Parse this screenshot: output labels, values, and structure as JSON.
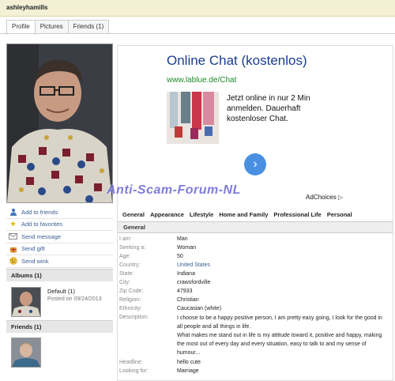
{
  "topbar": {
    "username": "ashleyhamills"
  },
  "tabs": [
    {
      "label": "Profile",
      "active": true
    },
    {
      "label": "Pictures",
      "active": false
    },
    {
      "label": "Friends (1)",
      "active": false
    }
  ],
  "actions": [
    {
      "label": "Add to friends",
      "icon": "person-icon"
    },
    {
      "label": "Add to favorites",
      "icon": "star-icon"
    },
    {
      "label": "Send message",
      "icon": "envelope-icon"
    },
    {
      "label": "Send gift",
      "icon": "gift-icon"
    },
    {
      "label": "Send wink",
      "icon": "smiley-icon"
    }
  ],
  "albums": {
    "heading": "Albums (1)",
    "items": [
      {
        "name": "Default (1)",
        "posted": "Posted on 09/24/2013"
      }
    ]
  },
  "friends": {
    "heading": "Friends (1)"
  },
  "ad": {
    "title": "Online Chat (kostenlos)",
    "url": "www.lablue.de/Chat",
    "text": "Jetzt online in nur 2 Min anmelden. Dauerhaft kostenloser Chat.",
    "adchoices": "AdChoices"
  },
  "watermark": "Anti-Scam-Forum-NL",
  "profile_tabs": [
    "General",
    "Appearance",
    "Lifestyle",
    "Home and Family",
    "Professional Life",
    "Personal"
  ],
  "general": {
    "heading": "General",
    "fields": [
      {
        "key": "I am:",
        "value": "Man",
        "link": false
      },
      {
        "key": "Seeking a:",
        "value": "Woman",
        "link": false
      },
      {
        "key": "Age:",
        "value": "50",
        "link": false
      },
      {
        "key": "Country:",
        "value": "United States",
        "link": true
      },
      {
        "key": "State:",
        "value": "Indiana",
        "link": false
      },
      {
        "key": "City:",
        "value": "crawsfordville",
        "link": false
      },
      {
        "key": "Zip Code:",
        "value": "47933",
        "link": false
      },
      {
        "key": "Religion:",
        "value": "Christian",
        "link": false
      },
      {
        "key": "Ethnicity:",
        "value": "Caucasian (white)",
        "link": false
      },
      {
        "key": "Description:",
        "value": "I choose to be a happy positive person, I am pretty easy going, I look for the good in all people and all things in life.\nWhat makes me stand out in life is my attitude toward it, positive and happy, making the most out of every day and every situation, easy to talk to and my sense of humour...",
        "link": false
      },
      {
        "key": "Headline:",
        "value": "hello cute",
        "link": false
      },
      {
        "key": "Looking for:",
        "value": "Marriage",
        "link": false
      }
    ]
  }
}
